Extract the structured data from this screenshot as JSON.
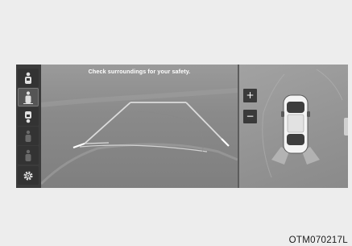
{
  "rear_view": {
    "warning": "Check surroundings for your safety."
  },
  "top_view": {
    "zoom_in": "+",
    "zoom_out": "−"
  },
  "toolbar": {
    "items": [
      {
        "icon": "rear-camera-view-icon",
        "selected": false
      },
      {
        "icon": "rear-top-camera-view-icon",
        "selected": true
      },
      {
        "icon": "front-camera-view-icon",
        "selected": false
      },
      {
        "icon": "side-camera-view-icon-disabled",
        "selected": false
      },
      {
        "icon": "side-top-camera-view-icon-disabled",
        "selected": false
      },
      {
        "icon": "settings-gear-icon",
        "selected": false
      }
    ]
  },
  "figure_code": "OTM070217L",
  "colors": {
    "guideline": "#d8d8d8",
    "toolbar": "#3b3b3b",
    "button": "#3a3a3a",
    "text": "#ffffff"
  }
}
